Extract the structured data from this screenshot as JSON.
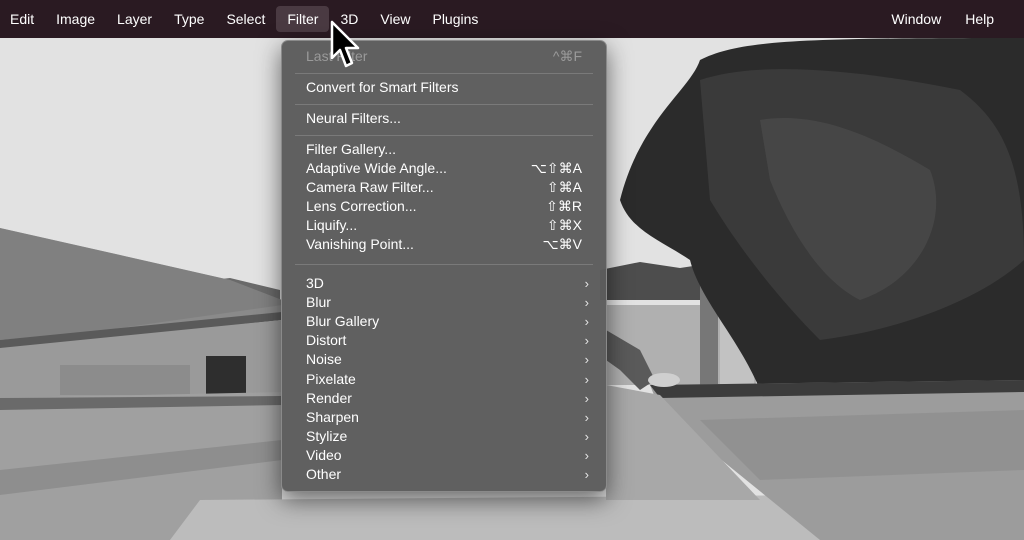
{
  "menubar": {
    "items": [
      "Edit",
      "Image",
      "Layer",
      "Type",
      "Select",
      "Filter",
      "3D",
      "View",
      "Plugins"
    ],
    "right_items": [
      "Window",
      "Help"
    ],
    "active": "Filter"
  },
  "filter_menu": {
    "last_filter": {
      "label": "Last Filter",
      "shortcut": "^⌘F"
    },
    "convert_smart": "Convert for Smart Filters",
    "neural": "Neural Filters...",
    "group1": [
      {
        "label": "Filter Gallery...",
        "shortcut": ""
      },
      {
        "label": "Adaptive Wide Angle...",
        "shortcut": "⌥⇧⌘A"
      },
      {
        "label": "Camera Raw Filter...",
        "shortcut": "⇧⌘A"
      },
      {
        "label": "Lens Correction...",
        "shortcut": "⇧⌘R"
      },
      {
        "label": "Liquify...",
        "shortcut": "⇧⌘X"
      },
      {
        "label": "Vanishing Point...",
        "shortcut": "⌥⌘V"
      }
    ],
    "submenus": [
      "3D",
      "Blur",
      "Blur Gallery",
      "Distort",
      "Noise",
      "Pixelate",
      "Render",
      "Sharpen",
      "Stylize",
      "Video",
      "Other"
    ],
    "chevron": "›"
  },
  "icons": {
    "cursor": "arrow-cursor-icon",
    "chevron": "chevron-right-icon"
  }
}
